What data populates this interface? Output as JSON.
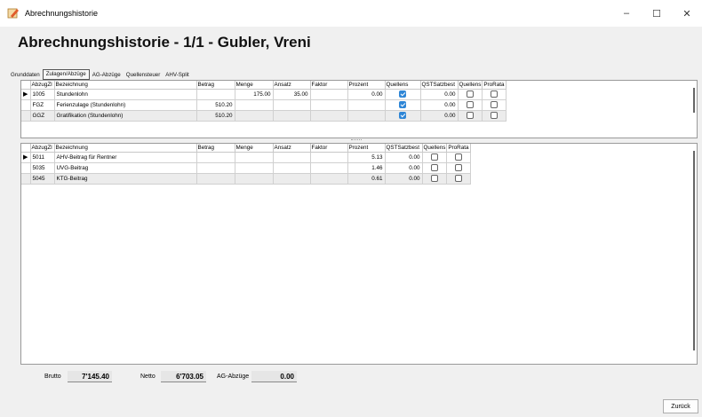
{
  "window": {
    "title": "Abrechnungshistorie",
    "minimize": "–",
    "maximize": "☐",
    "close": "✕"
  },
  "heading": "Abrechnungshistorie - 1/1 - Gubler, Vreni",
  "tabs": [
    {
      "label": "Grunddaten",
      "active": false
    },
    {
      "label": "Zulagen/Abzüge",
      "active": true
    },
    {
      "label": "AG-Abzüge",
      "active": false
    },
    {
      "label": "Quellensteuer",
      "active": false
    },
    {
      "label": "AHV-Split",
      "active": false
    }
  ],
  "zulagen": {
    "columns": [
      "AbzugZl",
      "Bezeichnung",
      "Betrag",
      "Menge",
      "Ansatz",
      "Faktor",
      "Prozent",
      "Quellens",
      "QSTSatzbest",
      "Quellens",
      "ProRata"
    ],
    "rows": [
      {
        "code": "1005",
        "bezeichnung": "Stundenlohn",
        "betrag": "",
        "menge": "175.00",
        "ansatz": "35.00",
        "faktor": "",
        "prozent": "0.00",
        "quellen": true,
        "qstsatz": "0.00",
        "quellen2": false,
        "prorata": false
      },
      {
        "code": "FGZ",
        "bezeichnung": "Ferienzulage (Stundenlohn)",
        "betrag": "510.20",
        "menge": "",
        "ansatz": "",
        "faktor": "",
        "prozent": "",
        "quellen": true,
        "qstsatz": "0.00",
        "quellen2": false,
        "prorata": false
      },
      {
        "code": "GGZ",
        "bezeichnung": "Gratifikation (Stundenlohn)",
        "betrag": "510.20",
        "menge": "",
        "ansatz": "",
        "faktor": "",
        "prozent": "",
        "quellen": true,
        "qstsatz": "0.00",
        "quellen2": false,
        "prorata": false
      }
    ]
  },
  "abzuege": {
    "columns": [
      "AbzugZl",
      "Bezeichnung",
      "Betrag",
      "Menge",
      "Ansatz",
      "Faktor",
      "Prozent",
      "QSTSatzbest",
      "Quellens",
      "ProRata"
    ],
    "rows": [
      {
        "code": "5011",
        "bezeichnung": "AHV-Beitrag für Rentner",
        "betrag": "",
        "menge": "",
        "ansatz": "",
        "faktor": "",
        "prozent": "5.13",
        "qstsatz": "0.00",
        "quellen": false,
        "prorata": false
      },
      {
        "code": "5035",
        "bezeichnung": "UVG-Beitrag",
        "betrag": "",
        "menge": "",
        "ansatz": "",
        "faktor": "",
        "prozent": "1.46",
        "qstsatz": "0.00",
        "quellen": false,
        "prorata": false
      },
      {
        "code": "5045",
        "bezeichnung": "KTG-Beitrag",
        "betrag": "",
        "menge": "",
        "ansatz": "",
        "faktor": "",
        "prozent": "0.61",
        "qstsatz": "0.00",
        "quellen": false,
        "prorata": false
      }
    ]
  },
  "totals": {
    "brutto_label": "Brutto",
    "brutto_value": "7'145.40",
    "netto_label": "Netto",
    "netto_value": "6'703.05",
    "ag_label": "AG-Abzüge",
    "ag_value": "0.00"
  },
  "buttons": {
    "back": "Zurück"
  },
  "colors": {
    "checkbox_checked": "#2f86d6"
  }
}
